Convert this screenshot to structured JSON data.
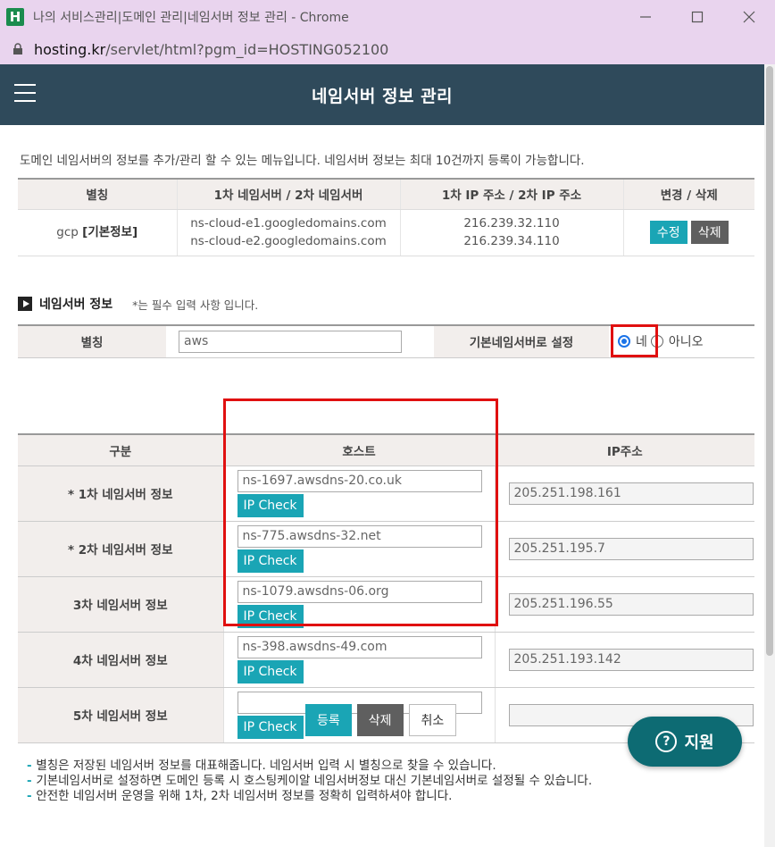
{
  "window": {
    "app_icon_letter": "H",
    "title": "나의 서비스관리|도메인 관리|네임서버 정보 관리 - Chrome",
    "url_domain": "hosting.kr",
    "url_path": "/servlet/html?pgm_id=HOSTING052100"
  },
  "header": {
    "title": "네임서버 정보 관리"
  },
  "intro": "도메인 네임서버의 정보를 추가/관리 할 수 있는 메뉴입니다. 네임서버 정보는 최대 10건까지 등록이 가능합니다.",
  "summary_table": {
    "headers": [
      "별칭",
      "1차 네임서버 / 2차 네임서버",
      "1차 IP 주소 / 2차 IP 주소",
      "변경 / 삭제"
    ],
    "row": {
      "alias": "gcp",
      "alias_tag": "[기본정보]",
      "ns1": "ns-cloud-e1.googledomains.com",
      "ns2": "ns-cloud-e2.googledomains.com",
      "ip1": "216.239.32.110",
      "ip2": "216.239.34.110",
      "edit_label": "수정",
      "delete_label": "삭제"
    }
  },
  "section": {
    "title": "네임서버 정보",
    "note": "*는 필수 입력 사항 입니다."
  },
  "alias_form": {
    "alias_label": "별칭",
    "alias_value": "aws",
    "default_label": "기본네임서버로 설정",
    "yes_label": "네",
    "no_label": "아니오",
    "selected": "yes"
  },
  "ns_table": {
    "headers": [
      "구분",
      "호스트",
      "IP주소"
    ],
    "ipcheck_label": "IP Check",
    "rows": [
      {
        "label": "* 1차 네임서버 정보",
        "host": "ns-1697.awsdns-20.co.uk",
        "ip": "205.251.198.161"
      },
      {
        "label": "* 2차 네임서버 정보",
        "host": "ns-775.awsdns-32.net",
        "ip": "205.251.195.7"
      },
      {
        "label": "3차 네임서버 정보",
        "host": "ns-1079.awsdns-06.org",
        "ip": "205.251.196.55"
      },
      {
        "label": "4차 네임서버 정보",
        "host": "ns-398.awsdns-49.com",
        "ip": "205.251.193.142"
      },
      {
        "label": "5차 네임서버 정보",
        "host": "",
        "ip": ""
      }
    ]
  },
  "actions": {
    "register": "등록",
    "delete": "삭제",
    "cancel": "취소"
  },
  "notes": [
    "별칭은 저장된 네임서버 정보를 대표해줍니다. 네임서버 입력 시 별칭으로 찾을 수 있습니다.",
    "기본네임서버로 설정하면 도메인 등록 시 호스팅케이알 네임서버정보 대신 기본네임서버로 설정될 수 있습니다.",
    "안전한 네임서버 운영을 위해 1차, 2차 네임서버 정보를 정확히 입력하셔야 합니다."
  ],
  "support": {
    "label": "지원",
    "icon": "question-icon"
  },
  "colors": {
    "header_bg": "#2f4a5b",
    "teal": "#1aa5b5",
    "highlight": "#e01010"
  }
}
